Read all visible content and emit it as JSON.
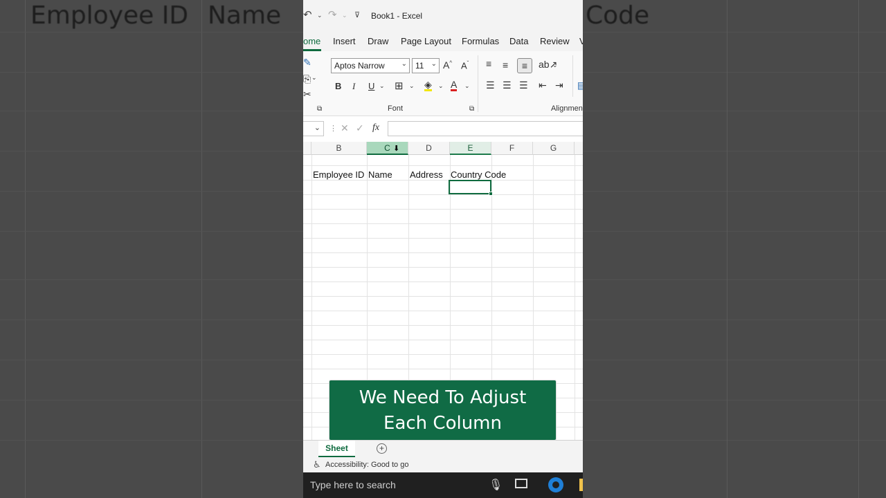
{
  "background": {
    "texts": [
      "Employee ID",
      "Name",
      "Code"
    ]
  },
  "window": {
    "title": "Book1  -  Excel"
  },
  "tabs": [
    "ome",
    "Insert",
    "Draw",
    "Page Layout",
    "Formulas",
    "Data",
    "Review",
    "V"
  ],
  "ribbon": {
    "font_name": "Aptos Narrow",
    "font_size": "11",
    "bold": "B",
    "italic": "I",
    "underline": "U",
    "group_font": "Font",
    "group_alignment": "Alignmen"
  },
  "formula_bar": {
    "fx": "fx",
    "value": ""
  },
  "columns": [
    "B",
    "C",
    "D",
    "E",
    "F",
    "G"
  ],
  "cells": {
    "b1": "Employee ID",
    "c1": "Name",
    "d1": "Address",
    "e1": "Country Code"
  },
  "caption": {
    "line1": "We Need To Adjust",
    "line2": "Each Column"
  },
  "sheet_tab": "Sheet",
  "status": {
    "accessibility": "Accessibility: Good to go"
  },
  "taskbar": {
    "search_placeholder": "Type here to search"
  },
  "colors": {
    "accent": "#0f6b3f",
    "caption_bg": "#106b45"
  }
}
